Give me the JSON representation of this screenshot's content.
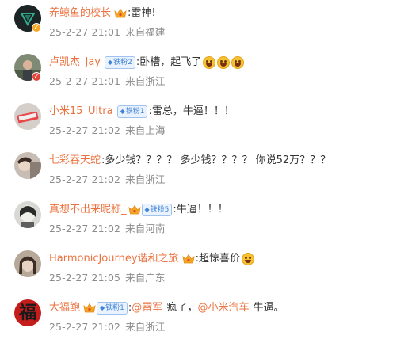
{
  "comments": [
    {
      "username": "养鲸鱼的校长",
      "verified": true,
      "fan_badge": "",
      "crown": true,
      "content": ":雷神!",
      "date": "25-2-27 21:01",
      "location": "来自福建",
      "avatar_color": "#1f4f45"
    },
    {
      "username": "卢凯杰_Jay",
      "verified": true,
      "fan_badge": "铁粉2",
      "crown": false,
      "content": ":卧槽，起飞了",
      "emoji_count": 3,
      "date": "25-2-27 21:01",
      "location": "来自浙江",
      "avatar_color": "#6c7a62"
    },
    {
      "username": "小米15_Ultra",
      "verified": false,
      "fan_badge": "铁粉1",
      "crown": false,
      "content": ":雷总，牛逼！！！",
      "date": "25-2-27 21:02",
      "location": "来自上海",
      "avatar_color": "#c8c2bb"
    },
    {
      "username": "七彩吞天蛇",
      "verified": false,
      "fan_badge": "",
      "crown": false,
      "content": ":多少钱？？？？ 多少钱？？？？ 你说52万？？？",
      "date": "25-2-27 21:02",
      "location": "来自浙江",
      "avatar_color": "#b9aca2"
    },
    {
      "username": "真想不出来昵称_",
      "verified": false,
      "fan_badge": "铁粉5",
      "crown": true,
      "content": ":牛逼！！！",
      "date": "25-2-27 21:02",
      "location": "来自河南",
      "avatar_color": "#a9a9a4"
    },
    {
      "username": "HarmonicJourney谐和之旅",
      "verified": false,
      "fan_badge": "",
      "crown": true,
      "content": ":超惊喜价",
      "emoji_count": 1,
      "date": "25-2-27 21:05",
      "location": "来自广东",
      "avatar_color": "#9c8e80"
    },
    {
      "username": "大福鲍",
      "verified": false,
      "fan_badge": "铁粉1",
      "crown": true,
      "content_prefix": ":",
      "mention1": "@雷军",
      "content_mid": " 疯了，",
      "mention2": "@小米汽车",
      "content_suffix": " 牛逼。",
      "date": "25-2-27 21:02",
      "location": "来自浙江",
      "avatar_color": "#c51c1c",
      "avatar_glyph": "福"
    }
  ],
  "colors": {
    "username": "#eb7340",
    "content": "#333333",
    "meta": "#8c8c8c",
    "fan_badge": "#3f83d9"
  }
}
